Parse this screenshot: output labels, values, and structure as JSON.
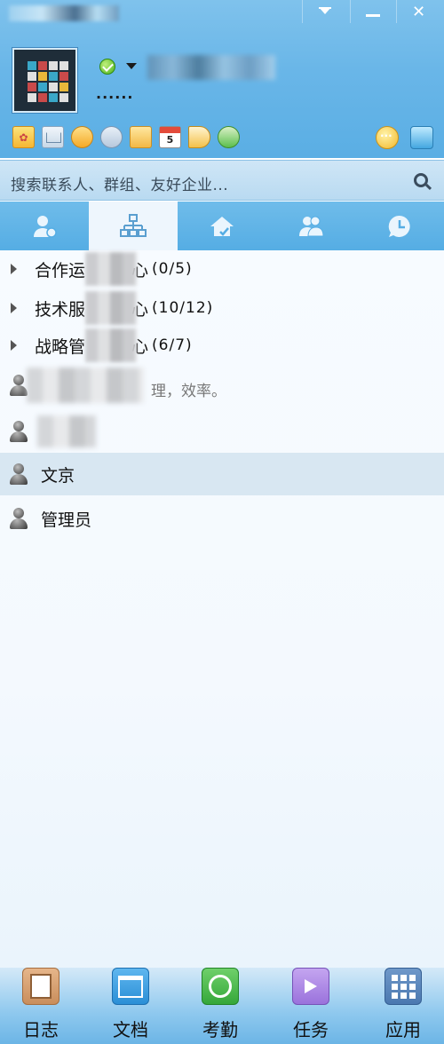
{
  "window": {
    "menu_glyph": "▼",
    "minimize_glyph": "–",
    "close_glyph": "✕"
  },
  "profile": {
    "signature": "......"
  },
  "toolbar": {
    "calendar_day": "5",
    "icons": [
      "qzone-icon",
      "mail-icon",
      "message-icon",
      "settings-gear-icon",
      "folder-icon",
      "calendar-icon",
      "announcement-icon",
      "contacts-icon"
    ],
    "right_icons": [
      "chat-bubble-icon",
      "skin-shirt-icon"
    ]
  },
  "search": {
    "placeholder": "搜索联系人、群组、友好企业..."
  },
  "tabs": [
    {
      "name": "contacts",
      "icon": "person-icon"
    },
    {
      "name": "organization",
      "icon": "org-chart-icon",
      "active": true
    },
    {
      "name": "enterprise",
      "icon": "house-icon"
    },
    {
      "name": "groups",
      "icon": "group-icon"
    },
    {
      "name": "recent",
      "icon": "clock-icon"
    }
  ],
  "groups": [
    {
      "name_start": "合作运",
      "name_end": "心",
      "count": "(0/5)"
    },
    {
      "name_start": "技术服",
      "name_end": "心",
      "count": "(10/12)"
    },
    {
      "name_start": "战略管",
      "name_end": "心",
      "count": "(6/7)"
    }
  ],
  "contact_blurred_signature": "理，效率。",
  "contacts": [
    {
      "name": "文京",
      "selected": true
    },
    {
      "name": "管理员",
      "selected": false
    }
  ],
  "bottom_apps": [
    {
      "label": "日志",
      "icon": "journal-icon"
    },
    {
      "label": "文档",
      "icon": "folder-icon"
    },
    {
      "label": "考勤",
      "icon": "attendance-check-icon"
    },
    {
      "label": "任务",
      "icon": "task-flag-icon"
    },
    {
      "label": "应用",
      "icon": "apps-grid-icon"
    }
  ],
  "colors": {
    "header": "#69b6e8",
    "selected_row": "#d8e7f2",
    "list_bg": "#f4f9fe"
  }
}
